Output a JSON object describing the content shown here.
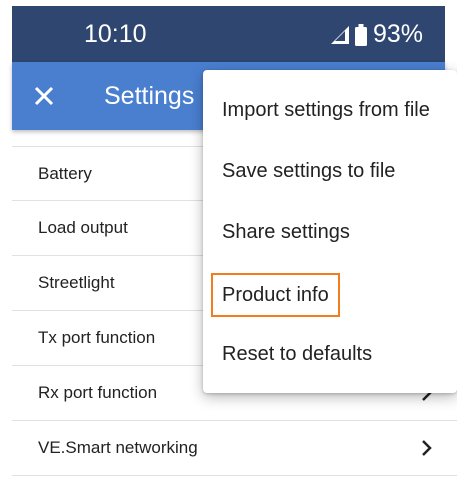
{
  "status_bar": {
    "time": "10:10",
    "battery_pct": "93%"
  },
  "app_bar": {
    "title": "Settings"
  },
  "list": [
    {
      "label": "Battery"
    },
    {
      "label": "Load output"
    },
    {
      "label": "Streetlight"
    },
    {
      "label": "Tx port function"
    },
    {
      "label": "Rx port function"
    },
    {
      "label": "VE.Smart networking"
    }
  ],
  "menu": [
    {
      "label": "Import settings from file"
    },
    {
      "label": "Save settings to file"
    },
    {
      "label": "Share settings"
    },
    {
      "label": "Product info",
      "highlighted": true
    },
    {
      "label": "Reset to defaults"
    }
  ]
}
